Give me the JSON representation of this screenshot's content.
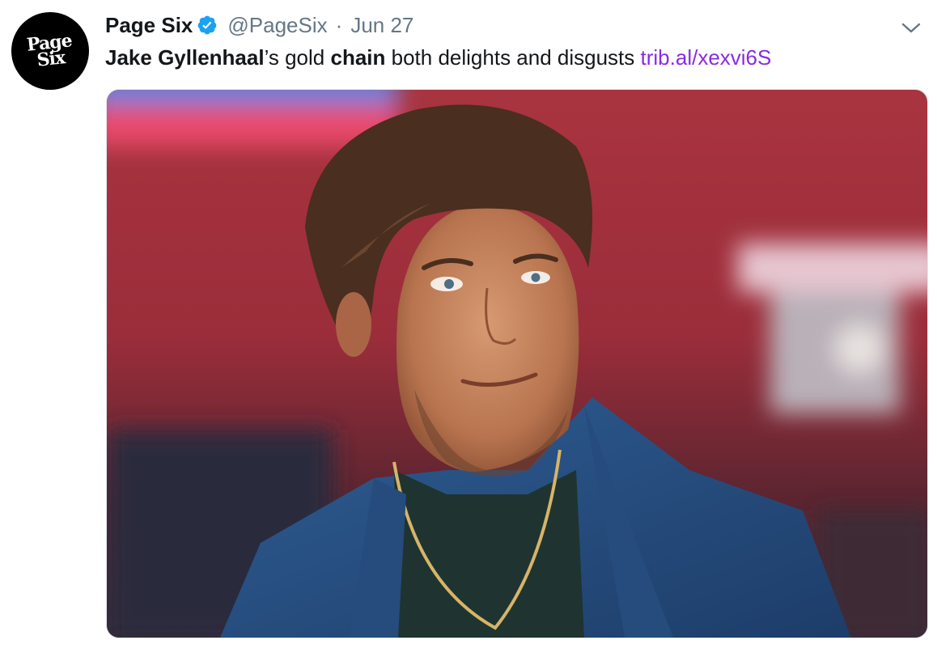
{
  "tweet": {
    "avatar": {
      "line1": "Page",
      "line2": "Six",
      "background": "#000000",
      "icon": "page-six-logo"
    },
    "display_name": "Page Six",
    "verified_icon": "verified-badge-icon",
    "handle": "@PageSix",
    "separator": "·",
    "date": "Jun 27",
    "menu_icon": "chevron-down-icon",
    "text": {
      "part1": "Jake Gyllenhaal",
      "part2": "’s gold ",
      "part3": "chain",
      "part4": " both delights and disgusts ",
      "link": "trib.al/xexvi6S"
    },
    "media": {
      "kind": "photo"
    }
  },
  "colors": {
    "text": "#14171a",
    "secondary": "#657786",
    "link": "#8a2be2",
    "verified": "#1da1f2"
  }
}
